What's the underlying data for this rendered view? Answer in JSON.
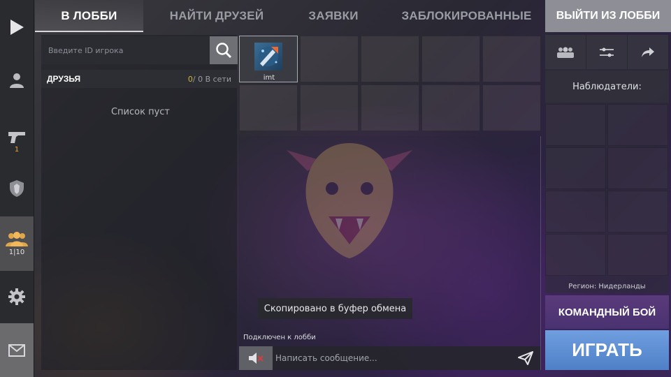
{
  "sidebar": {
    "weapons_count": "1",
    "lobby_count": "1|10"
  },
  "tabs": [
    {
      "label": "В ЛОББИ"
    },
    {
      "label": "НАЙТИ ДРУЗЕЙ"
    },
    {
      "label": "ЗАЯВКИ"
    },
    {
      "label": "ЗАБЛОКИРОВАННЫЕ"
    }
  ],
  "leave_button": "ВЫЙТИ ИЗ ЛОББИ",
  "friends": {
    "search_placeholder": "Введите ID игрока",
    "title": "ДРУЗЬЯ",
    "online_count": "0",
    "online_suffix": "/ 0 В сети",
    "empty_text": "Список пуст"
  },
  "lobby": {
    "player_name": "imt"
  },
  "chat": {
    "toast": "Скопировано в буфер обмена",
    "status": "Подключен к лобби",
    "placeholder": "Написать сообщение..."
  },
  "right_panel": {
    "observers_label": "Наблюдатели:",
    "region": "Регион: Нидерланды",
    "mode_button": "КОМАНДНЫЙ БОЙ",
    "play_button": "ИГРАТЬ"
  },
  "colors": {
    "accent_orange": "#f0a83a",
    "play_blue": "#5b8ad6",
    "mode_purple": "#523679"
  }
}
